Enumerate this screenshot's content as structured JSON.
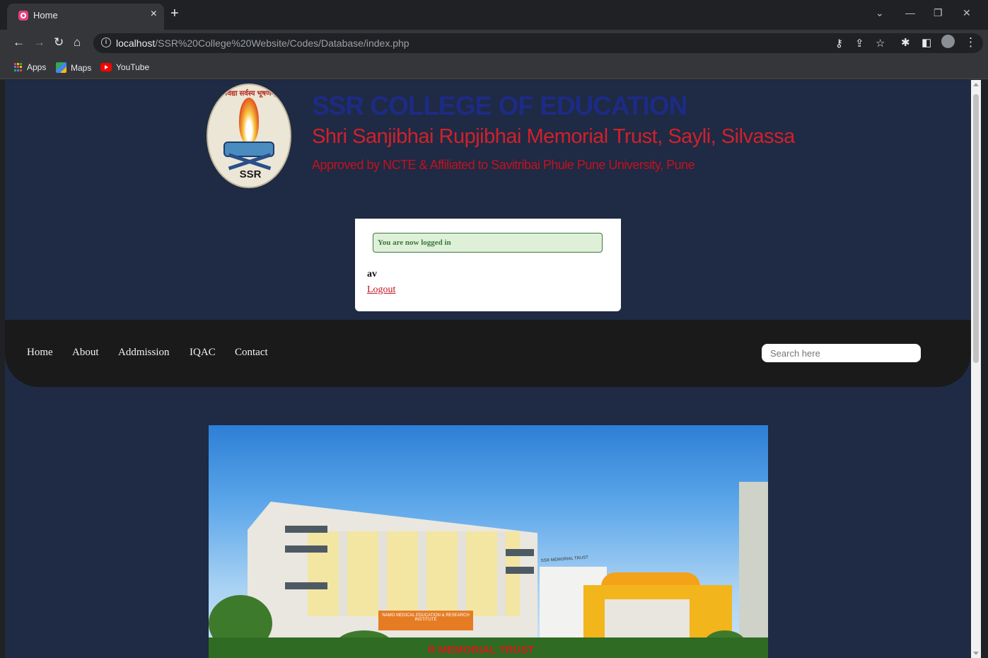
{
  "browser": {
    "tab_title": "Home",
    "tab_close": "×",
    "new_tab": "+",
    "url_host": "localhost",
    "url_path": "/SSR%20College%20Website/Codes/Database/index.php",
    "bookmarks": [
      {
        "label": "Apps",
        "icon": "apps-grid-icon"
      },
      {
        "label": "Maps",
        "icon": "maps-icon"
      },
      {
        "label": "YouTube",
        "icon": "youtube-icon"
      }
    ]
  },
  "header": {
    "title": "SSR COLLEGE OF EDUCATION",
    "subtitle": "Shri Sanjibhai Rupjibhai  Memorial Trust, Sayli, Silvassa",
    "approval": "Approved by NCTE & Affiliated to Savitribai Phule  Pune University, Pune",
    "logo_text": "SSR",
    "logo_motto": "विद्या सर्वस्य भूषणम्"
  },
  "login": {
    "success_message": "You are now logged in",
    "username": "av",
    "logout_label": "Logout"
  },
  "nav": {
    "items": [
      "Home",
      "About",
      "Addmission",
      "IQAC",
      "Contact"
    ],
    "search_placeholder": "Search here"
  },
  "hero": {
    "building_sign": "NAMO MEDICAL EDUCATION & RESEARCH INSTITUTE",
    "side_sign": "SSR MEMORIAL TRUST",
    "ground_text": "R MEMORIAL TRUST"
  },
  "colors": {
    "page_background": "#1f2a44",
    "title_blue": "#1d2b86",
    "subtitle_red": "#d0212a",
    "nav_background": "#1a1a1a",
    "success_green": "#3c763d"
  }
}
